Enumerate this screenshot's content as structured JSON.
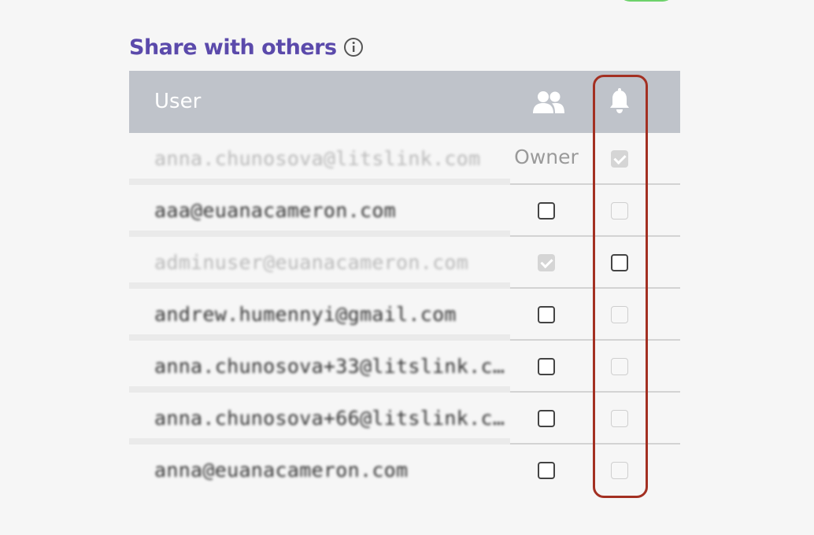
{
  "section": {
    "title": "Share with others",
    "info_icon": "info-icon"
  },
  "table": {
    "header": {
      "user_label": "User",
      "users_icon": "users-icon",
      "bell_icon": "bell-icon"
    },
    "rows": [
      {
        "email": "anna.chunosova@litslink.com",
        "role": "Owner",
        "access": null,
        "notify": "checked-disabled",
        "faded": true
      },
      {
        "email": "aaa@euanacameron.com",
        "role": "",
        "access": "unchecked",
        "notify": "unchecked-disabled",
        "faded": false
      },
      {
        "email": "adminuser@euanacameron.com",
        "role": "",
        "access": "checked-disabled",
        "notify": "unchecked",
        "faded": true
      },
      {
        "email": "andrew.humennyi@gmail.com",
        "role": "",
        "access": "unchecked",
        "notify": "unchecked-disabled",
        "faded": false
      },
      {
        "email": "anna.chunosova+33@litslink.co...",
        "role": "",
        "access": "unchecked",
        "notify": "unchecked-disabled",
        "faded": false
      },
      {
        "email": "anna.chunosova+66@litslink.c...",
        "role": "",
        "access": "unchecked",
        "notify": "unchecked-disabled",
        "faded": false
      },
      {
        "email": "anna@euanacameron.com",
        "role": "",
        "access": "unchecked",
        "notify": "unchecked-disabled",
        "faded": false
      }
    ]
  },
  "colors": {
    "title": "#5b4aab",
    "header_bg": "#bfc3ca",
    "highlight": "#a33022",
    "toggle": "#6dd26b"
  }
}
